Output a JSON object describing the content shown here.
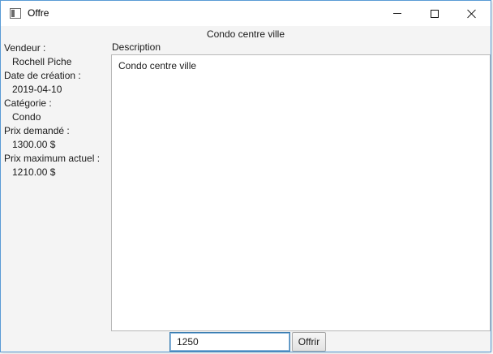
{
  "window": {
    "title": "Offre"
  },
  "header": {
    "title": "Condo centre ville"
  },
  "details": [
    {
      "label": "Vendeur :",
      "value": "Rochell Piche"
    },
    {
      "label": "Date de création :",
      "value": "2019-04-10"
    },
    {
      "label": "Catégorie :",
      "value": "Condo"
    },
    {
      "label": "Prix demandé :",
      "value": "1300.00 $"
    },
    {
      "label": "Prix maximum actuel :",
      "value": "1210.00 $"
    }
  ],
  "description": {
    "label": "Description",
    "text": "Condo centre ville"
  },
  "offer": {
    "input_value": "1250",
    "button_label": "Offrir"
  },
  "colors": {
    "focus_border": "#3c7fb1",
    "window_border": "#5a9bd5"
  }
}
